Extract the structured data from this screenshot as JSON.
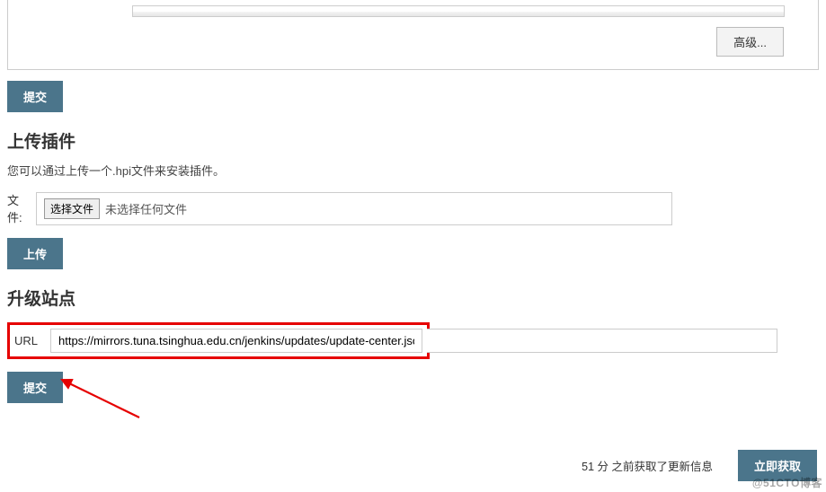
{
  "proxy": {
    "advanced_btn": "高级..."
  },
  "submit1": "提交",
  "upload_section": {
    "title": "上传插件",
    "desc": "您可以通过上传一个.hpi文件来安装插件。",
    "file_label": "文件:",
    "choose_file_btn": "选择文件",
    "no_file_text": "未选择任何文件",
    "upload_btn": "上传"
  },
  "upgrade_section": {
    "title": "升级站点",
    "url_label": "URL",
    "url_value": "https://mirrors.tuna.tsinghua.edu.cn/jenkins/updates/update-center.json",
    "submit_btn": "提交"
  },
  "footer": {
    "status_text": "51 分 之前获取了更新信息",
    "get_now_btn": "立即获取"
  },
  "watermark": "@51CTO博客"
}
